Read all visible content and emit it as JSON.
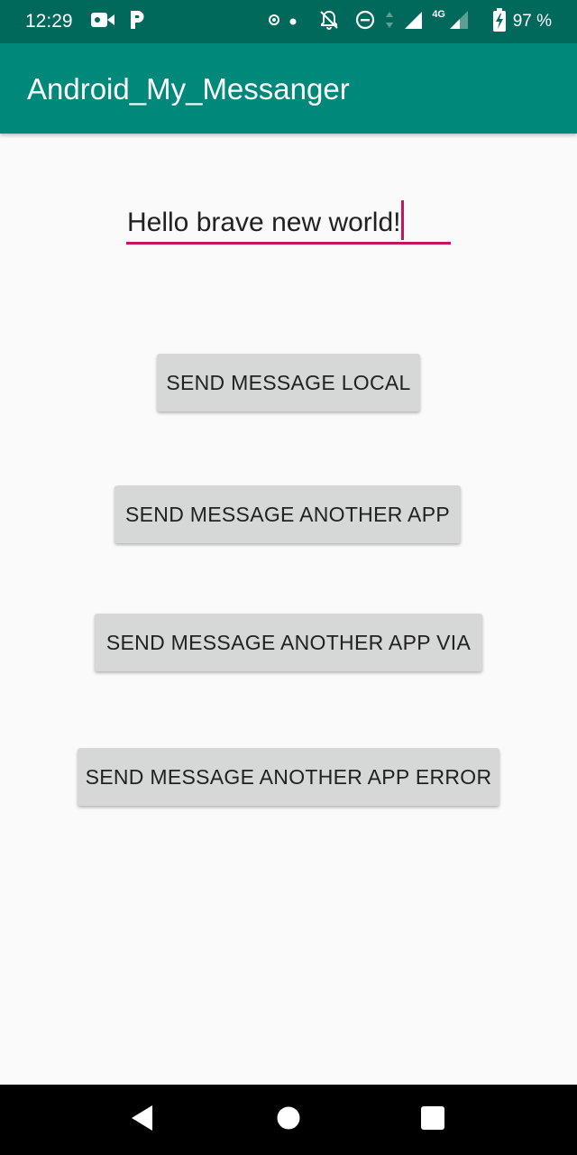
{
  "status_bar": {
    "time": "12:29",
    "network_label": "4G",
    "battery_percent": "97 %",
    "icons": [
      "video-camera-icon",
      "p-notification-icon",
      "nfc-icon",
      "dot-icon",
      "notifications-off-icon",
      "do-not-disturb-icon",
      "data-arrows-icon",
      "wifi-signal-icon",
      "cell-signal-icon",
      "battery-charging-icon"
    ],
    "background_color": "#00695c"
  },
  "app_bar": {
    "title": "Android_My_Messanger",
    "background_color": "#00897b"
  },
  "message_field": {
    "value": "Hello brave new world!",
    "accent_color": "#c2185b"
  },
  "buttons": {
    "send_local": "SEND MESSAGE LOCAL",
    "send_another_app": "SEND MESSAGE ANOTHER APP",
    "send_another_app_via": "SEND MESSAGE ANOTHER APP VIA",
    "send_another_app_error": "SEND MESSAGE ANOTHER APP ERROR"
  },
  "nav_bar": {
    "icons": [
      "back-icon",
      "home-icon",
      "recents-icon"
    ]
  }
}
